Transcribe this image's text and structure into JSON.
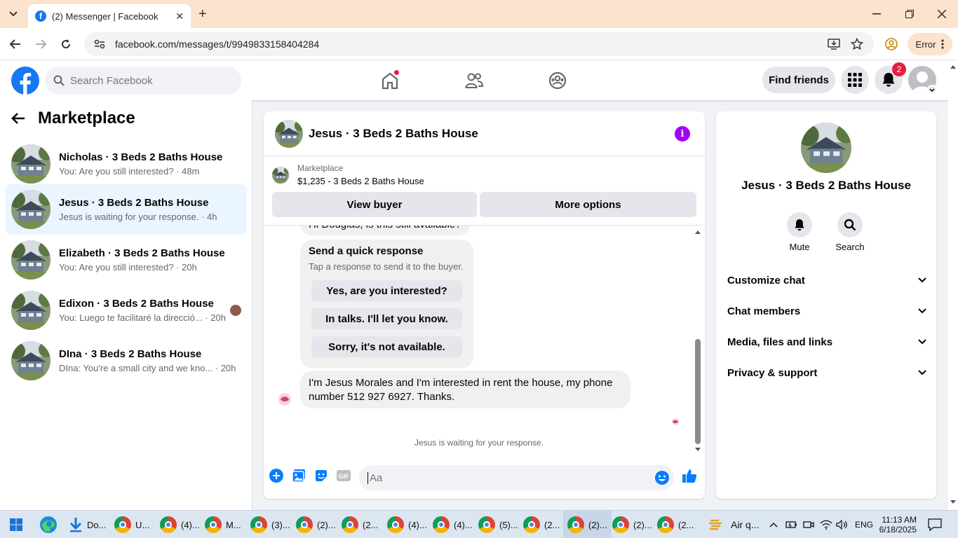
{
  "browser": {
    "tab_title": "(2) Messenger | Facebook",
    "favicon_letter": "f",
    "new_tab": "+",
    "close_tab": "✕",
    "url": "facebook.com/messages/t/9949833158404284",
    "error_label": "Error"
  },
  "fb_header": {
    "search_placeholder": "Search Facebook",
    "find_friends": "Find friends",
    "notification_count": "2"
  },
  "sidebar": {
    "title": "Marketplace",
    "conversations": [
      {
        "name": "Nicholas · 3 Beds 2 Baths House",
        "preview": "You: Are you still interested? · 48m"
      },
      {
        "name": "Jesus · 3 Beds 2 Baths House",
        "preview": "Jesus is waiting for your response. · 4h"
      },
      {
        "name": "Elizabeth · 3 Beds 2 Baths House",
        "preview": "You: Are you still interested? · 20h"
      },
      {
        "name": "Edixon · 3 Beds 2 Baths House",
        "preview": "You: Luego te facilitaré la direcció... · 20h"
      },
      {
        "name": "DIna · 3 Beds 2 Baths House",
        "preview": "DIna: You're a small city and we kno... · 20h"
      }
    ]
  },
  "chat": {
    "title": "Jesus · 3 Beds 2 Baths House",
    "info_icon": "i",
    "marketplace_label": "Marketplace",
    "listing": "$1,235 - 3 Beds 2 Baths House",
    "view_buyer": "View buyer",
    "more_options": "More options",
    "partial_message": "Hi Douglas, is this still available?",
    "quick_response": {
      "title": "Send a quick response",
      "subtitle": "Tap a response to send it to the buyer.",
      "options": [
        "Yes, are you interested?",
        "In talks. I'll let you know.",
        "Sorry, it's not available."
      ]
    },
    "buyer_message_line1": "I'm Jesus Morales and I'm interested in rent the house, my phone",
    "buyer_message_line2": "number 512 927 6927. Thanks.",
    "waiting_text": "Jesus is waiting for your response.",
    "composer_placeholder": "Aa"
  },
  "right_panel": {
    "name": "Jesus · 3 Beds 2 Baths House",
    "mute": "Mute",
    "search": "Search",
    "sections": [
      "Customize chat",
      "Chat members",
      "Media, files and links",
      "Privacy & support"
    ]
  },
  "taskbar": {
    "items": [
      {
        "label": "Do...",
        "icon": "download-icon"
      },
      {
        "label": "U...",
        "icon": "chrome-icon"
      },
      {
        "label": "(4)...",
        "icon": "chrome-icon"
      },
      {
        "label": "M...",
        "icon": "chrome-icon"
      },
      {
        "label": "(3)...",
        "icon": "chrome-icon"
      },
      {
        "label": "(2)...",
        "icon": "chrome-icon"
      },
      {
        "label": "(2...",
        "icon": "chrome-icon"
      },
      {
        "label": "(4)...",
        "icon": "chrome-icon"
      },
      {
        "label": "(4)...",
        "icon": "chrome-icon"
      },
      {
        "label": "(5)...",
        "icon": "chrome-icon"
      },
      {
        "label": "(2...",
        "icon": "chrome-icon"
      },
      {
        "label": "(2)...",
        "icon": "chrome-icon"
      },
      {
        "label": "(2)...",
        "icon": "chrome-icon"
      },
      {
        "label": "(2...",
        "icon": "chrome-icon"
      }
    ],
    "weather": "Air q...",
    "language": "ENG",
    "time": "11:13 AM",
    "date": "6/18/2025"
  },
  "colors": {
    "fb_blue": "#1877f2",
    "messenger_purple": "#a400ff",
    "selected_conv": "#ebf5ff",
    "tabstrip": "#fbe3cd"
  }
}
